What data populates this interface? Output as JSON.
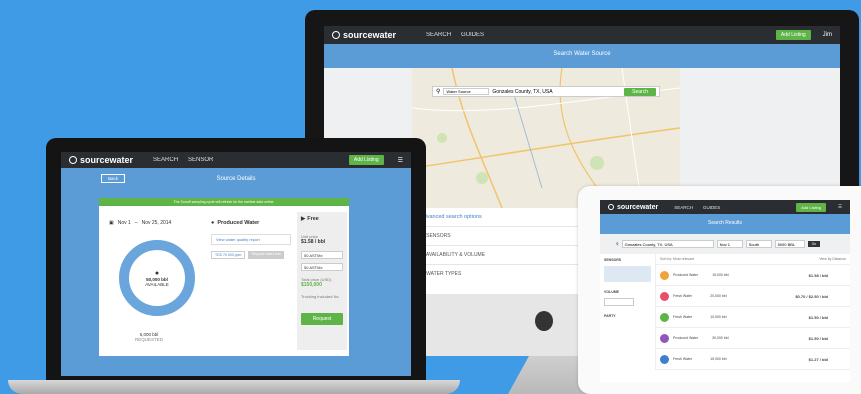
{
  "brand": {
    "name": "sourcewater",
    "accent": "#5fb447",
    "band": "#5b9bd6",
    "topbar": "#2a2d31"
  },
  "imac": {
    "nav": [
      "SEARCH",
      "GUIDES"
    ],
    "cta": "Add Listing",
    "user": "Jim",
    "band_title": "Search Water Source",
    "search": {
      "type": "Water Source",
      "location": "Gonzales County, TX, USA",
      "button": "Search"
    },
    "advanced": {
      "title": "Advanced search options",
      "rows": [
        "SENSORS",
        "AVAILABILITY & VOLUME",
        "WATER TYPES"
      ]
    }
  },
  "laptop": {
    "nav": [
      "SEARCH",
      "SENSOR"
    ],
    "cta": "Add Listing",
    "back": "Back",
    "band_title": "Source Details",
    "notice": "The Sonoff sampling cycle will refresh for the earliest data online.",
    "dates": {
      "from": "Nov 1",
      "to": "Nov 25, 2014"
    },
    "donut": {
      "value": "50,000 bbl",
      "caption": "AVAILABLE"
    },
    "total": {
      "value": "5,000 bbl",
      "caption": "REQUESTED"
    },
    "water": {
      "title": "Produced Water",
      "quality_link": "View water quality report",
      "btn1": "TDS 70,000 ppm",
      "btn2": "Request water test"
    },
    "pricing": {
      "label": "Free",
      "unit_label": "Unit price",
      "unit_price": "$1.58 / bbl",
      "qty1": "50 ASTMx",
      "qty2": "50 ASTMx",
      "total_label": "Total price (USD)",
      "total": "$150,000",
      "trucking_label": "Trucking Included",
      "trucking_note": "No",
      "request": "Request"
    }
  },
  "tablet": {
    "cta": "Add Listing",
    "nav": [
      "SEARCH",
      "GUIDES"
    ],
    "band_title": "Search Results",
    "search": {
      "location": "Gonzales County, TX, USA",
      "type": "Nov 1",
      "dest": "South",
      "amount": "5000 BBL",
      "go": "Go"
    },
    "sidebar": [
      "SENSORS",
      "VOLUME",
      "PARTY"
    ],
    "sort": "Sort by: Most relevant",
    "view_link": "View by Distance",
    "results": [
      {
        "color": "#f2a23b",
        "type": "Produced Water",
        "qty": "15,000 bbl",
        "price": "$1.58 / bbl"
      },
      {
        "color": "#e84e6b",
        "type": "Fresh Water",
        "qty": "20,000 bbl",
        "price": "$0.70 / $2.50 / bbl"
      },
      {
        "color": "#5fb447",
        "type": "Fresh Water",
        "qty": "10,000 bbl",
        "price": "$1.50 / bbl"
      },
      {
        "color": "#9156b8",
        "type": "Produced Water",
        "qty": "30,000 bbl",
        "price": "$1.50 / bbl"
      },
      {
        "color": "#3f7fcc",
        "type": "Fresh Water",
        "qty": "15,000 bbl",
        "price": "$1.27 / bbl"
      }
    ]
  }
}
